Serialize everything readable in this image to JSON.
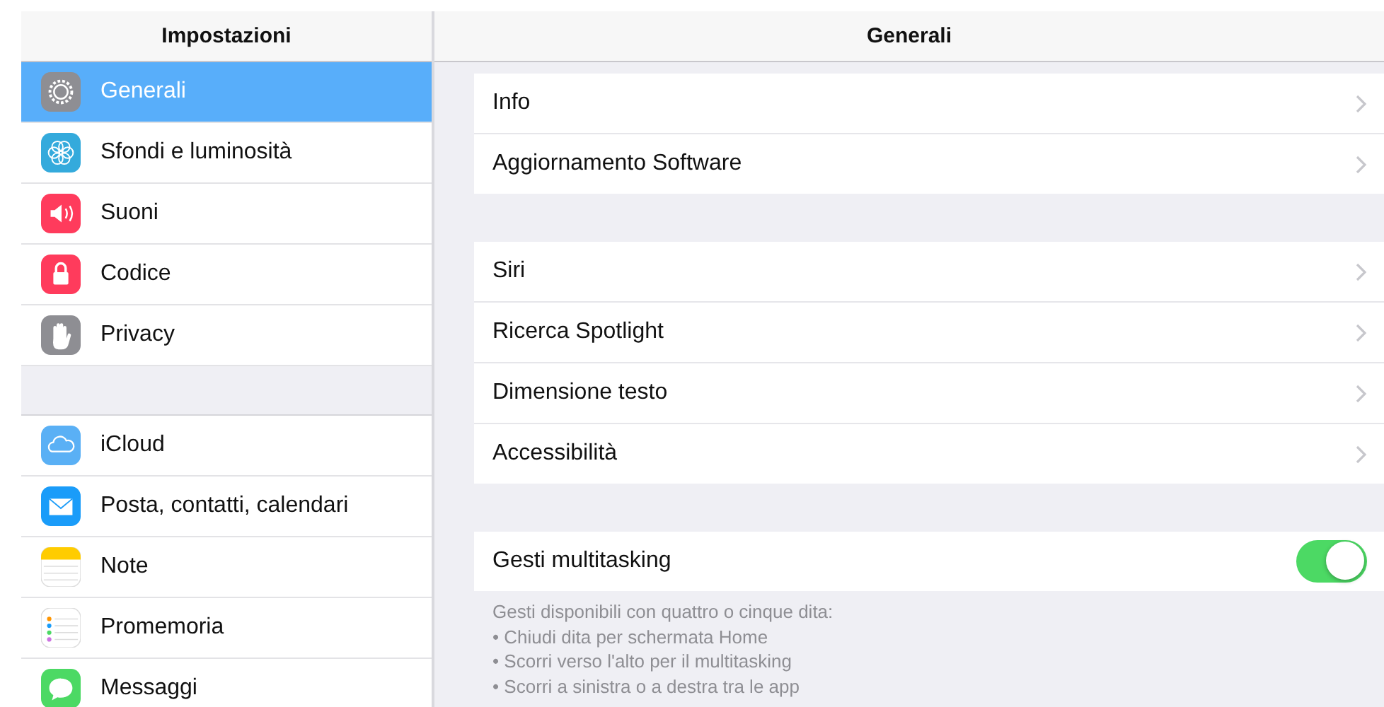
{
  "sidebar": {
    "title": "Impostazioni",
    "groups": [
      [
        {
          "label": "Generali",
          "selected": true
        },
        {
          "label": "Sfondi e luminosità",
          "selected": false
        },
        {
          "label": "Suoni",
          "selected": false
        },
        {
          "label": "Codice",
          "selected": false
        },
        {
          "label": "Privacy",
          "selected": false
        }
      ],
      [
        {
          "label": "iCloud",
          "selected": false
        },
        {
          "label": "Posta, contatti, calendari",
          "selected": false
        },
        {
          "label": "Note",
          "selected": false
        },
        {
          "label": "Promemoria",
          "selected": false
        },
        {
          "label": "Messaggi",
          "selected": false
        }
      ]
    ]
  },
  "detail": {
    "title": "Generali",
    "groups": [
      [
        {
          "label": "Info",
          "kind": "link"
        },
        {
          "label": "Aggiornamento Software",
          "kind": "link"
        }
      ],
      [
        {
          "label": "Siri",
          "kind": "link"
        },
        {
          "label": "Ricerca Spotlight",
          "kind": "link"
        },
        {
          "label": "Dimensione testo",
          "kind": "link"
        },
        {
          "label": "Accessibilità",
          "kind": "link"
        }
      ],
      [
        {
          "label": "Gesti multitasking",
          "kind": "toggle",
          "on": true
        }
      ]
    ],
    "footer": [
      "Gesti disponibili con quattro o cinque dita:",
      "• Chiudi dita per schermata Home",
      "• Scorri verso l'alto per il multitasking",
      "• Scorri a sinistra o a destra tra le app"
    ]
  }
}
